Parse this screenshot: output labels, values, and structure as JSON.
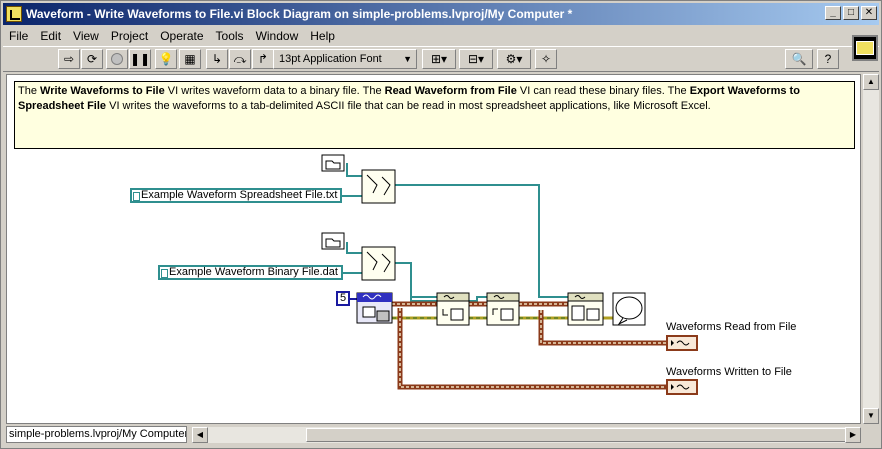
{
  "window": {
    "title": "Waveform - Write Waveforms to File.vi Block Diagram on simple-problems.lvproj/My Computer *"
  },
  "menu": {
    "items": [
      "File",
      "Edit",
      "View",
      "Project",
      "Operate",
      "Tools",
      "Window",
      "Help"
    ]
  },
  "toolbar": {
    "font_label": "13pt Application Font",
    "icons": [
      "run-arrow-icon",
      "run-continuously-icon",
      "abort-icon",
      "pause-icon",
      "highlight-execution-icon",
      "retain-wire-values-icon",
      "step-into-icon",
      "step-over-icon",
      "step-out-icon",
      "align-objects-icon",
      "distribute-objects-icon",
      "reorder-icon",
      "cleanup-diagram-icon",
      "search-icon",
      "help-icon"
    ]
  },
  "comment": {
    "t1": "The ",
    "b1": "Write Waveforms to File",
    "t2": " VI writes waveform data to a binary file. The ",
    "b2": "Read Waveform from File",
    "t3": " VI can read these binary files. The ",
    "b3": "Export Waveforms to Spreadsheet File",
    "t4": " VI writes the waveforms to a tab-delimited ASCII file that can be read in most spreadsheet applications, like Microsoft Excel."
  },
  "diagram": {
    "spreadsheet_path": "Example Waveform Spreadsheet File.txt",
    "binary_path": "Example Waveform Binary File.dat",
    "num_const": "5",
    "label_read": "Waveforms Read from File",
    "label_written": "Waveforms Written to File"
  },
  "status": {
    "context": "simple-problems.lvproj/My Computer"
  },
  "colors": {
    "title_gradient_start": "#0a246a",
    "path_wire": "#2f8f8f",
    "error_wire": "#8b3a1a",
    "comment_bg": "#ffffe0"
  }
}
